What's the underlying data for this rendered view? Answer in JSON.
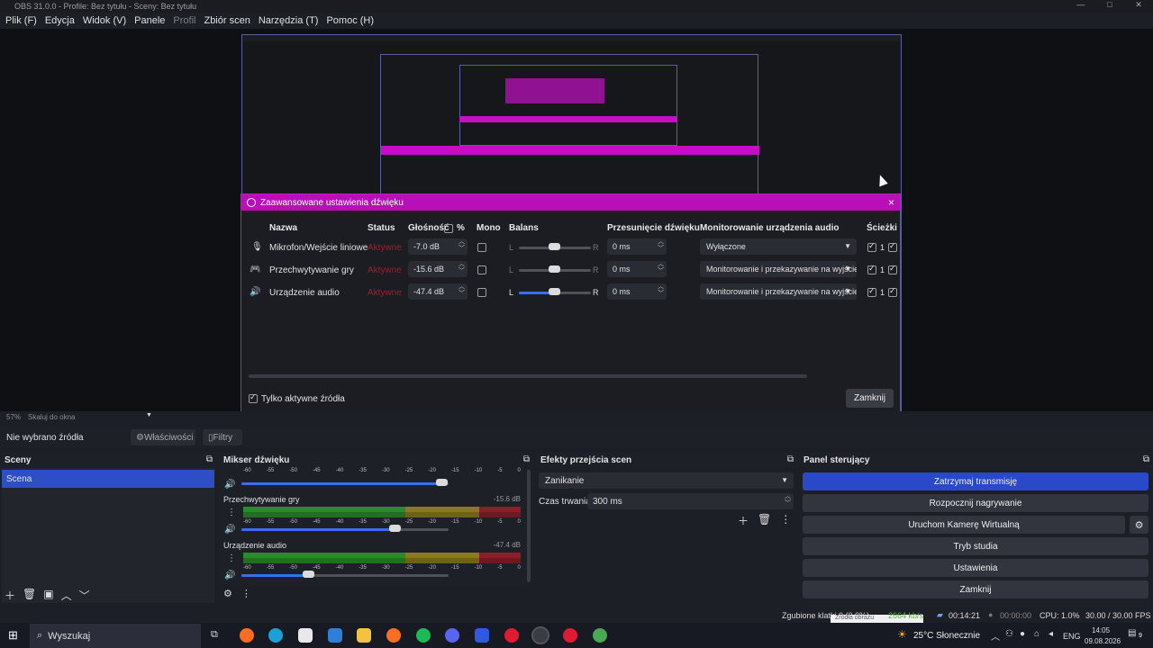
{
  "window": {
    "title": "OBS 31.0.0 - Profile: Bez tytułu - Sceny: Bez tytułu",
    "controls": [
      "—",
      "□",
      "✕"
    ]
  },
  "menu": [
    "Plik (F)",
    "Edycja",
    "Widok (V)",
    "Panele",
    "Profil",
    "Zbiór scen",
    "Narzędzia (T)",
    "Pomoc (H)"
  ],
  "dialog": {
    "title": "Zaawansowane ustawienia dźwięku",
    "close": "×",
    "headers": {
      "name": "Nazwa",
      "status": "Status",
      "volume": "Głośność",
      "percent": "%",
      "mono": "Mono",
      "balance": "Balans",
      "sync": "Przesunięcie dźwięku",
      "monitoring": "Monitorowanie urządzenia audio",
      "tracks": "Ścieżki"
    },
    "rows": [
      {
        "icon": "microphone-icon",
        "glyph": "🎙",
        "name": "Mikrofon/Wejście liniowe",
        "status": "Aktywne",
        "volume": "-7.0 dB",
        "balance_l": "L",
        "balance_r": "R",
        "sync": "0 ms",
        "monitoring": "Wyłączone",
        "track": "1"
      },
      {
        "icon": "gamepad-icon",
        "glyph": "🎮",
        "name": "Przechwytywanie gry",
        "status": "Aktywne",
        "volume": "-15.6 dB",
        "balance_l": "L",
        "balance_r": "R",
        "sync": "0 ms",
        "monitoring": "Monitorowanie i przekazywanie na wyjście",
        "track": "1"
      },
      {
        "icon": "speaker-icon",
        "glyph": "🔊",
        "name": "Urządzenie audio",
        "status": "Aktywne",
        "volume": "-47.4 dB",
        "balance_l": "L",
        "balance_r": "R",
        "sync": "0 ms",
        "monitoring": "Monitorowanie i przekazywanie na wyjście",
        "track": "1"
      }
    ],
    "active_only": "Tylko aktywne źródła",
    "close_button": "Zamknij"
  },
  "preview_bar": {
    "zoom": "57%",
    "scale": "Skaluj do okna"
  },
  "source_bar": {
    "no_source": "Nie wybrano źródła",
    "properties": "Właściwości",
    "filters": "Filtry"
  },
  "scenes": {
    "title": "Sceny",
    "items": [
      "Scena"
    ]
  },
  "mixer": {
    "title": "Mikser dźwięku",
    "ticks": [
      "-60",
      "-55",
      "-50",
      "-45",
      "-40",
      "-35",
      "-30",
      "-25",
      "-20",
      "-15",
      "-10",
      "-5",
      "0"
    ],
    "channels": [
      {
        "name": "Przechwytywanie gry",
        "db": "-15.6 dB"
      },
      {
        "name": "Urządzenie audio",
        "db": "-47.4 dB"
      }
    ]
  },
  "transitions": {
    "title": "Efekty przejścia scen",
    "selected": "Zanikanie",
    "duration_label": "Czas trwania",
    "duration": "300 ms"
  },
  "controls": {
    "title": "Panel sterujący",
    "buttons": [
      "Zatrzymaj transmisję",
      "Rozpocznij nagrywanie",
      "Uruchom Kamerę Wirtualną",
      "Tryb studia",
      "Ustawienia",
      "Zamknij"
    ]
  },
  "statusbar": {
    "dropped": "Zgubione klatki 0 (0.0%)",
    "kbps": "2664 kb/s",
    "live": "00:14:21",
    "rec": "00:00:00",
    "cpu": "CPU: 1.0%",
    "fps": "30.00 / 30.00 FPS",
    "tooltip": "Źródła obrazu"
  },
  "taskbar": {
    "search": "Wyszukaj",
    "weather": "25°C  Słonecznie",
    "lang": "ENG",
    "time": "14:05",
    "date": "09.08.2026",
    "notifications": "9"
  },
  "colors": {
    "accent": "#c40fc4",
    "selected": "#2d4ec4",
    "stop_stream": "#2a49c8"
  }
}
